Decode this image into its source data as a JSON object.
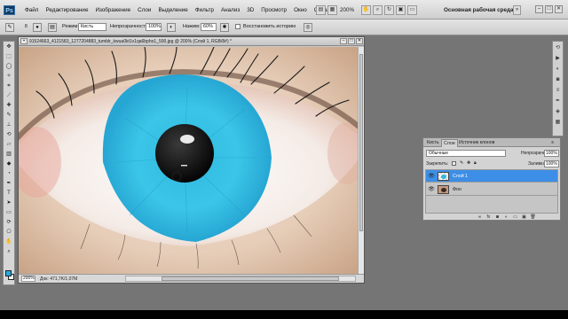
{
  "menubar": {
    "logo": "Ps",
    "items": [
      "Файл",
      "Редактирование",
      "Изображение",
      "Слои",
      "Выделение",
      "Фильтр",
      "Анализ",
      "3D",
      "Просмотр",
      "Окно",
      "Справка"
    ],
    "zoom": "200%",
    "workspace": "Основная рабочая среда"
  },
  "options": {
    "brush_size": "8",
    "mode_label": "Режим:",
    "mode_value": "Кисть",
    "opacity_label": "Непрозрачность:",
    "opacity_value": "100%",
    "pressure_label": "Нажим:",
    "pressure_value": "60%",
    "restore_label": "Восстановить историю"
  },
  "document": {
    "title": "91524663_4121583_1277204883_tumblr_kwua0kt1v1qa6bpho1_500.jpg @ 200% (Слой 1, RGB/8#) *",
    "zoom": "200%",
    "doc_size": "Док: 471,7K/1,07M"
  },
  "layers_panel": {
    "tabs": [
      "Кисть",
      "Слои",
      "Источник клонов"
    ],
    "blend_mode": "Обычные",
    "opacity_label": "Непрозрачность:",
    "opacity_value": "100%",
    "lock_label": "Закрепить:",
    "fill_label": "Заливка:",
    "fill_value": "100%",
    "layers": [
      {
        "name": "Слой 1",
        "selected": true
      },
      {
        "name": "Фон",
        "selected": false
      }
    ]
  },
  "colors": {
    "foreground": "#27a9e0",
    "background": "#ffffff",
    "selected_layer": "#3d8ee6"
  }
}
